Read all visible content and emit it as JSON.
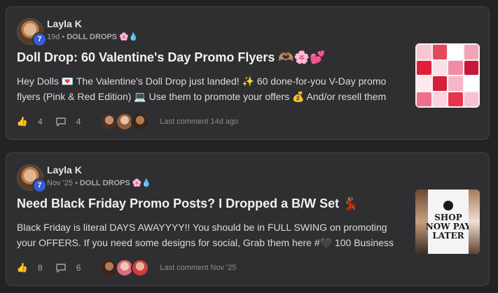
{
  "posts": [
    {
      "author": "Layla K",
      "level": "7",
      "time": "19d",
      "category": "DOLL DROPS",
      "category_emoji": "🌸💧",
      "title": "Doll Drop: 60 Valentine's Day Promo Flyers 🫶🏽🌸💕",
      "body": "Hey Dolls 💌 The Valentine's Doll Drop just landed! ✨ 60 done-for-you V-Day promo flyers (Pink & Red Edition) 💻 Use them to promote your offers 💰 And/or resell them",
      "likes": "4",
      "comments": "4",
      "last_comment": "Last comment 14d ago"
    },
    {
      "author": "Layla K",
      "level": "7",
      "time": "Nov '25",
      "category": "DOLL DROPS",
      "category_emoji": "🌸💧",
      "title": "Need Black Friday Promo Posts? I Dropped a B/W Set 💃🏽",
      "body": "Black Friday is literal DAYS AWAYYYY!! You should be in FULL SWING on promoting your OFFERS. If you need some designs for social, Grab them here #🖤 100 Business",
      "likes": "8",
      "comments": "6",
      "last_comment": "Last comment Nov '25",
      "thumbnail_text": "SHOP NOW PAY LATER"
    }
  ],
  "colors": {
    "background": "#232325",
    "card": "#2f2f31",
    "level_badge": "#3b5bd6"
  },
  "icons": [
    "like-icon",
    "comment-icon"
  ]
}
